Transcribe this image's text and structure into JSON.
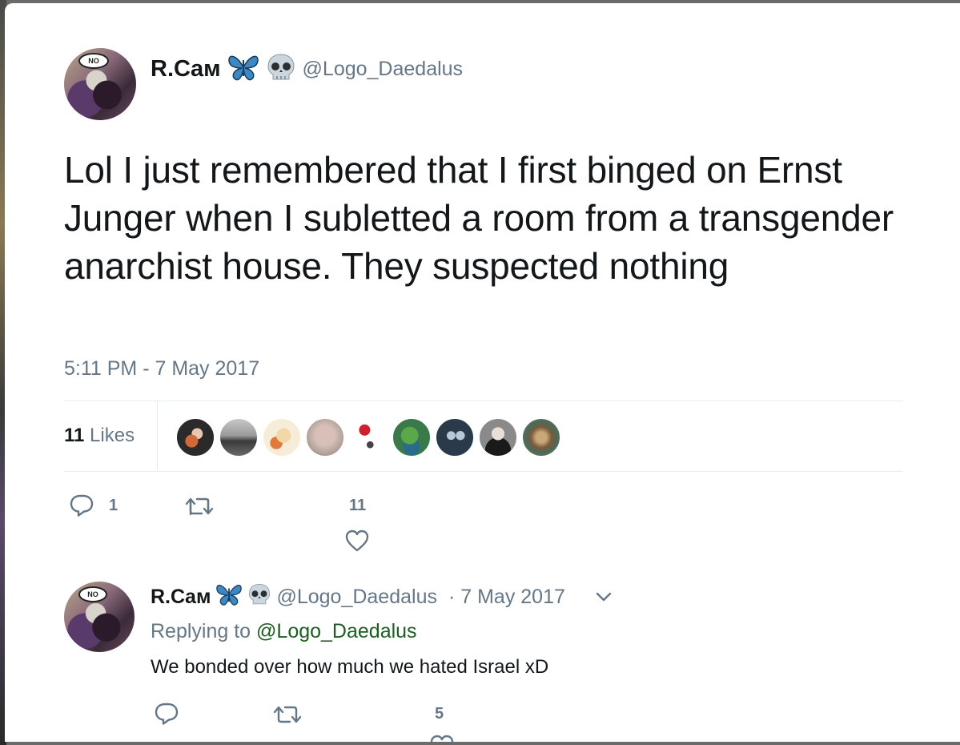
{
  "tweet": {
    "display_name": "R.Cам",
    "emoji": [
      "butterfly-icon",
      "skull-icon"
    ],
    "handle": "@Logo_Daedalus",
    "avatar_bubble": "NO",
    "text": "Lol I just remembered that I first binged on Ernst Junger when I subletted a room from a transgender anarchist house. They suspected nothing",
    "timestamp": "5:11 PM - 7 May 2017",
    "likes_count": "11",
    "likes_label": "Likes",
    "likers": [
      "liker-1",
      "liker-2",
      "liker-3",
      "liker-4",
      "liker-5",
      "liker-6",
      "liker-7",
      "liker-8",
      "liker-9"
    ],
    "reply_count": "1",
    "retweet_count": "",
    "like_count": "11"
  },
  "reply": {
    "display_name": "R.Cам",
    "handle": "@Logo_Daedalus",
    "date": "· 7 May 2017",
    "replying_prefix": "Replying to",
    "replying_to": "@Logo_Daedalus",
    "text": "We bonded over how much we hated Israel xD",
    "like_count": "5"
  },
  "colors": {
    "text": "#14171a",
    "secondary": "#657786",
    "divider": "#e6ecf0",
    "butterfly": "#3b88c3",
    "mention": "#1b5e20"
  }
}
